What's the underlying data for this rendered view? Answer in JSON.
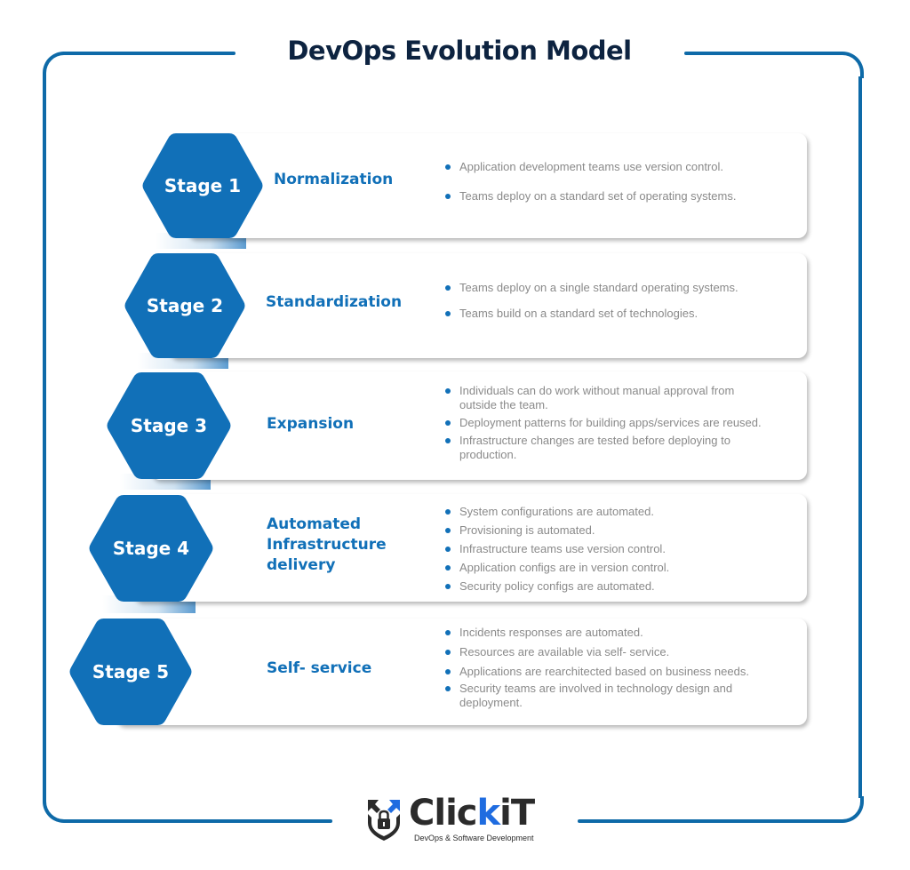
{
  "title": "DevOps Evolution Model",
  "colors": {
    "frame": "#0e6aa8",
    "hexagon": "#1170b8",
    "title": "#0d2340",
    "stage_name": "#1170b8",
    "bullet_text": "#8a8a8a",
    "bullet_dot": "#1170b8"
  },
  "stages": [
    {
      "label": "Stage 1",
      "name": "Normalization",
      "bullets": [
        "Application development teams use version control.",
        "Teams deploy on a standard set of operating systems."
      ]
    },
    {
      "label": "Stage 2",
      "name": "Standardization",
      "bullets": [
        "Teams deploy on a single standard operating systems.",
        "Teams build on a standard set of technologies."
      ]
    },
    {
      "label": "Stage 3",
      "name": "Expansion",
      "bullets": [
        "Individuals can do work without manual approval from outside the team.",
        "Deployment patterns for building apps/services are reused.",
        "Infrastructure changes are tested before deploying to production."
      ]
    },
    {
      "label": "Stage 4",
      "name": "Automated Infrastructure delivery",
      "name_lines": [
        "Automated",
        "Infrastructure",
        "delivery"
      ],
      "bullets": [
        "System configurations are automated.",
        "Provisioning is automated.",
        "Infrastructure teams use version control.",
        "Application configs are in version control.",
        "Security policy configs are automated."
      ]
    },
    {
      "label": "Stage 5",
      "name": "Self- service",
      "bullets": [
        "Incidents responses are automated.",
        "Resources are available via self- service.",
        "Applications are rearchitected based on business needs.",
        "Security teams are involved in technology design and deployment."
      ]
    }
  ],
  "logo": {
    "word_prefix": "Clic",
    "word_k": "k",
    "word_suffix": "iT",
    "tagline": "DevOps & Software Development",
    "icon": "shield-lock-icon"
  }
}
